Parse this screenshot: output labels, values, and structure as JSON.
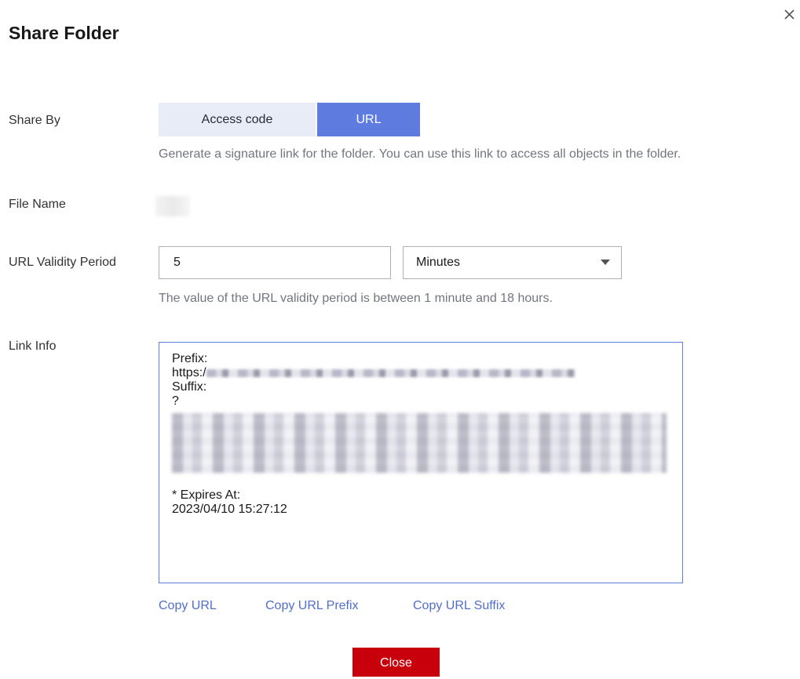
{
  "dialog": {
    "title": "Share Folder",
    "close_icon": "close-icon"
  },
  "share_by": {
    "label": "Share By",
    "options": [
      "Access code",
      "URL"
    ],
    "selected": "URL",
    "hint": "Generate a signature link for the folder. You can use this link to access all objects in the folder."
  },
  "file_name": {
    "label": "File Name"
  },
  "validity": {
    "label": "URL Validity Period",
    "value": "5",
    "unit": "Minutes",
    "hint": "The value of the URL validity period is between 1 minute and 18 hours."
  },
  "link_info": {
    "label": "Link Info",
    "prefix_label": "Prefix:",
    "prefix_start": "https:/",
    "suffix_label": "Suffix:",
    "suffix_start": "?",
    "expires_label": "* Expires At:",
    "expires_value": "2023/04/10 15:27:12"
  },
  "actions": {
    "copy_url": "Copy URL",
    "copy_prefix": "Copy URL Prefix",
    "copy_suffix": "Copy URL Suffix",
    "close": "Close"
  },
  "colors": {
    "primary": "#5e7ce0",
    "danger": "#c7000b",
    "link": "#526ecc"
  }
}
